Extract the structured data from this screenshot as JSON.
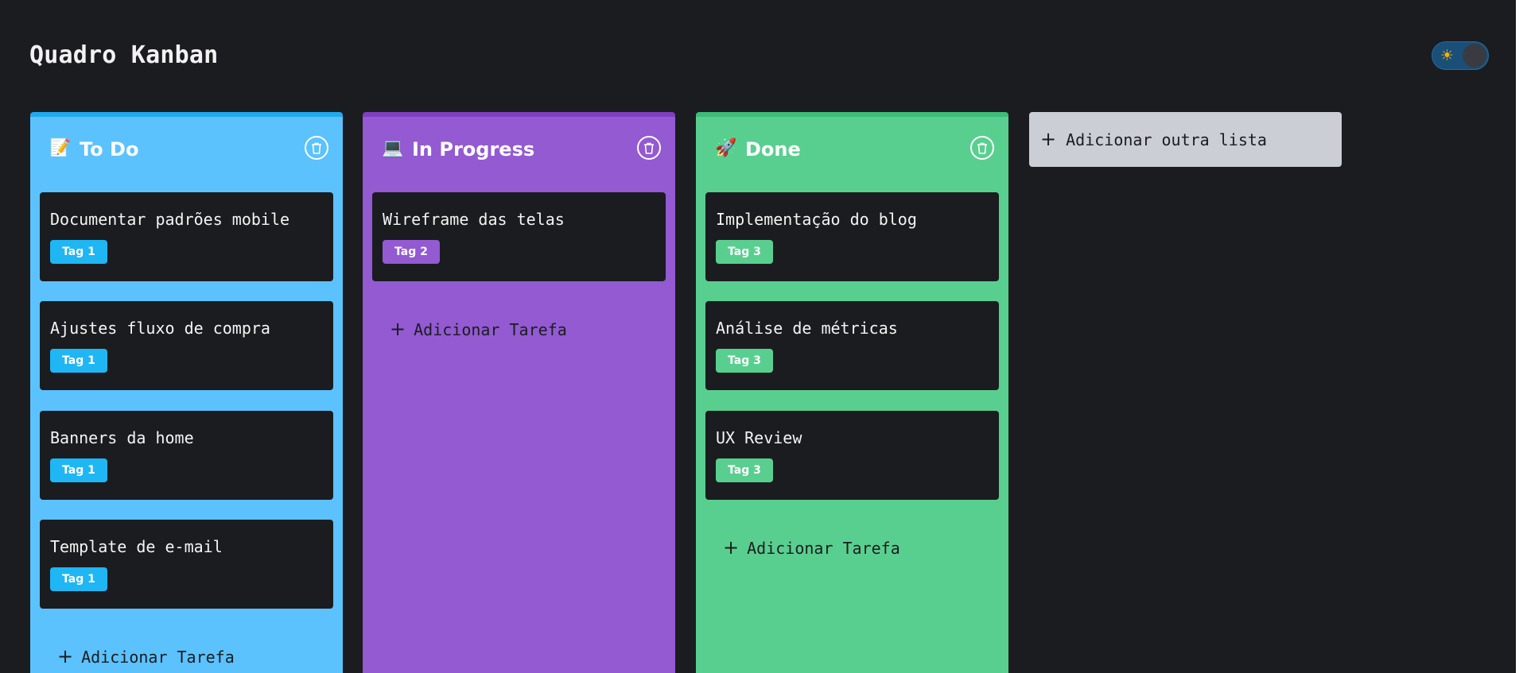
{
  "header": {
    "title": "Quadro Kanban",
    "theme_toggle_icon": "☀"
  },
  "colors": {
    "background": "#1b1c20",
    "todo": "#5bc2fd",
    "todo_accent": "#1fa9f0",
    "in_progress": "#935ad2",
    "in_progress_accent": "#7e3fc2",
    "done": "#59cf8f",
    "done_accent": "#3dbd77",
    "add_list_bg": "#cbced4"
  },
  "columns": [
    {
      "icon": "📝",
      "icon_name": "memo-icon",
      "title": "To Do",
      "cards": [
        {
          "title": "Documentar padrões mobile",
          "tag": "Tag 1"
        },
        {
          "title": "Ajustes fluxo de compra",
          "tag": "Tag 1"
        },
        {
          "title": "Banners da home",
          "tag": "Tag 1"
        },
        {
          "title": "Template de e-mail",
          "tag": "Tag 1"
        }
      ],
      "add_task_label": "Adicionar Tarefa"
    },
    {
      "icon": "💻",
      "icon_name": "laptop-icon",
      "title": "In Progress",
      "cards": [
        {
          "title": "Wireframe das telas",
          "tag": "Tag 2"
        }
      ],
      "add_task_label": "Adicionar Tarefa"
    },
    {
      "icon": "🚀",
      "icon_name": "rocket-icon",
      "title": "Done",
      "cards": [
        {
          "title": "Implementação do blog",
          "tag": "Tag 3"
        },
        {
          "title": "Análise de métricas",
          "tag": "Tag 3"
        },
        {
          "title": "UX Review",
          "tag": "Tag 3"
        }
      ],
      "add_task_label": "Adicionar Tarefa"
    }
  ],
  "add_list": {
    "plus": "+",
    "label": "Adicionar outra lista"
  },
  "add_task_plus": "+"
}
